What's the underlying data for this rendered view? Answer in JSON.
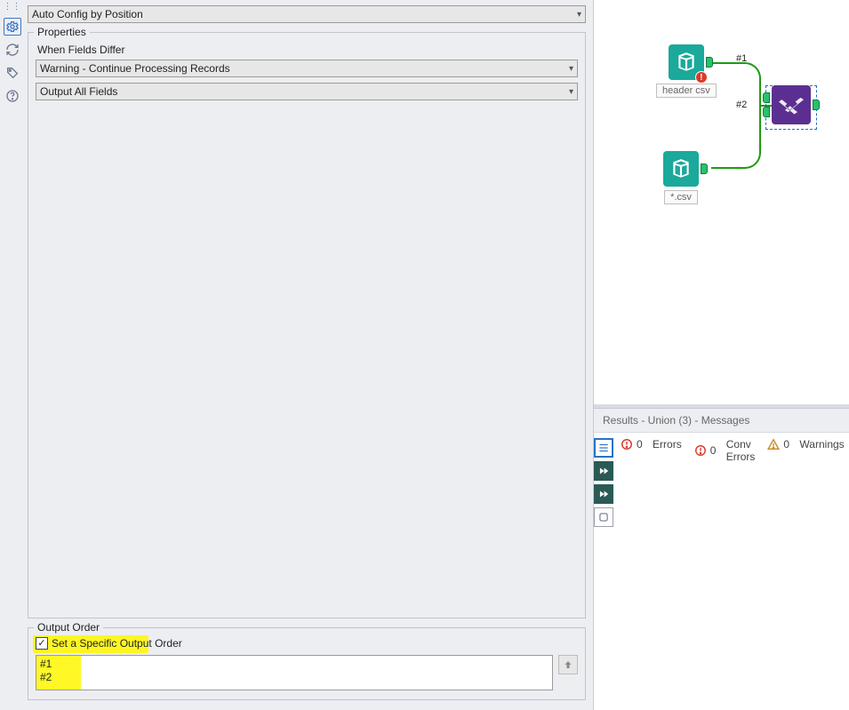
{
  "rail": {
    "icons": [
      "gear",
      "refresh",
      "tag",
      "help"
    ]
  },
  "config": {
    "mode_select": "Auto Config by Position",
    "properties": {
      "legend": "Properties",
      "when_fields_differ_label": "When Fields Differ",
      "when_fields_differ_value": "Warning - Continue Processing Records",
      "output_mode_value": "Output All Fields"
    },
    "output_order": {
      "legend": "Output Order",
      "checkbox_label": "Set a Specific Output Order",
      "checkbox_checked": true,
      "items": [
        "#1",
        "#2"
      ]
    }
  },
  "canvas": {
    "nodes": {
      "input1": {
        "label": "header csv",
        "has_error": true
      },
      "input2": {
        "label": "*.csv",
        "has_error": false
      },
      "union": {
        "selected": true
      }
    },
    "ports": {
      "p1": "#1",
      "p2": "#2"
    }
  },
  "results": {
    "header": "Results - Union (3) - Messages",
    "errors_count": 0,
    "errors_label": "Errors",
    "conv_errors_count": 0,
    "conv_errors_label": "Conv Errors",
    "warnings_count": 0,
    "warnings_label": "Warnings"
  }
}
